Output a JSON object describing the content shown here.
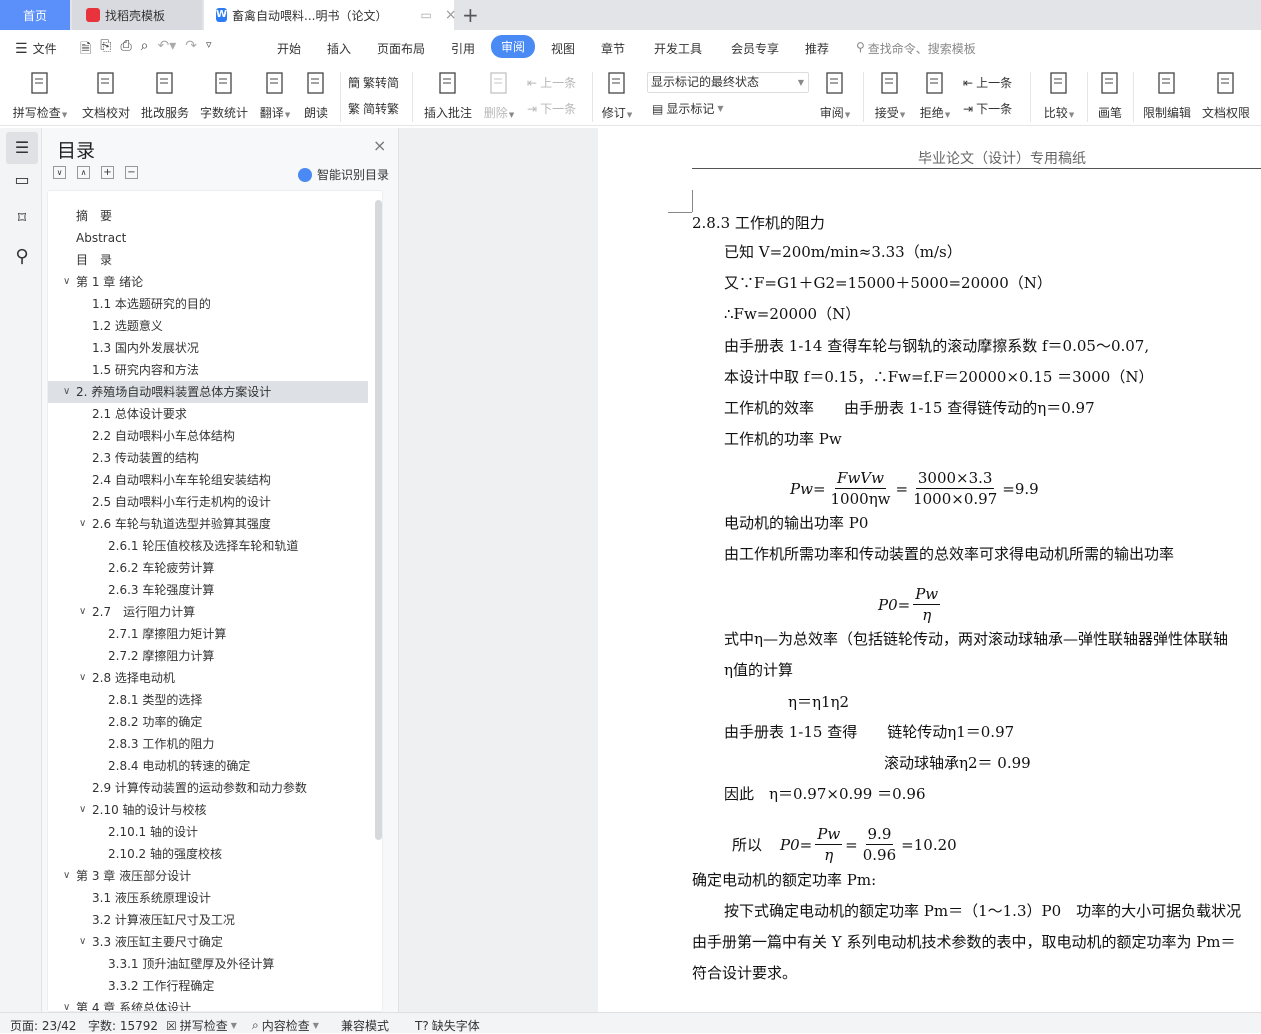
{
  "tabs": {
    "home": "首页",
    "template": "找稻壳模板",
    "doc": "畜禽自动喂料...明书（论文）",
    "new": "+"
  },
  "colors": {
    "accent": "#4a8af4",
    "home_tab": "#5b8ff9",
    "template_icon": "#e8323c",
    "doc_icon": "#2b7cf6"
  },
  "menu": {
    "file": "文件",
    "tabs": [
      "开始",
      "插入",
      "页面布局",
      "引用",
      "审阅",
      "视图",
      "章节",
      "开发工具",
      "会员专享",
      "推荐"
    ],
    "active": "审阅",
    "search_placeholder": "查找命令、搜索模板"
  },
  "ribbon": {
    "big": [
      {
        "label": "拼写检查",
        "dd": true,
        "icon": "spellcheck-icon"
      },
      {
        "label": "文档校对",
        "icon": "proofread-icon"
      },
      {
        "label": "批改服务",
        "icon": "correction-service-icon"
      },
      {
        "label": "字数统计",
        "icon": "word-count-icon"
      },
      {
        "label": "翻译",
        "dd": true,
        "icon": "translate-icon"
      },
      {
        "label": "朗读",
        "icon": "read-aloud-icon"
      },
      {
        "label": "插入批注",
        "icon": "insert-comment-icon"
      },
      {
        "label": "删除",
        "dd": true,
        "disabled": true,
        "icon": "delete-comment-icon"
      },
      {
        "label": "修订",
        "dd": true,
        "icon": "track-changes-icon"
      },
      {
        "label": "审阅",
        "dd": true,
        "icon": "review-pane-icon"
      },
      {
        "label": "接受",
        "dd": true,
        "icon": "accept-icon"
      },
      {
        "label": "拒绝",
        "dd": true,
        "icon": "reject-icon"
      },
      {
        "label": "比较",
        "dd": true,
        "icon": "compare-icon"
      },
      {
        "label": "画笔",
        "icon": "pen-icon"
      },
      {
        "label": "限制编辑",
        "icon": "restrict-edit-icon"
      },
      {
        "label": "文档权限",
        "icon": "doc-permission-icon"
      }
    ],
    "trad_to_simp": "繁转简",
    "simp_to_trad": "简转繁",
    "prev_comment": "上一条",
    "next_comment": "下一条",
    "markup_state": "显示标记的最终状态",
    "show_markup": "显示标记",
    "prev_change": "上一条",
    "next_change": "下一条"
  },
  "nav": {
    "title": "目录",
    "smart": "智能识别目录",
    "items": [
      {
        "t": "摘　要",
        "l": 0
      },
      {
        "t": "Abstract",
        "l": 0
      },
      {
        "t": "目　录",
        "l": 0
      },
      {
        "t": "第 1 章  绪论",
        "l": 0,
        "c": true
      },
      {
        "t": "1.1 本选题研究的目的",
        "l": 1
      },
      {
        "t": "1.2 选题意义",
        "l": 1
      },
      {
        "t": "1.3 国内外发展状况",
        "l": 1
      },
      {
        "t": "1.5 研究内容和方法",
        "l": 1
      },
      {
        "t": "2.  养殖场自动喂料装置总体方案设计",
        "l": 0,
        "c": true,
        "sel": true
      },
      {
        "t": "2.1  总体设计要求",
        "l": 1
      },
      {
        "t": "2.2  自动喂料小车总体结构",
        "l": 1
      },
      {
        "t": "2.3  传动装置的结构",
        "l": 1
      },
      {
        "t": "2.4  自动喂料小车车轮组安装结构",
        "l": 1
      },
      {
        "t": "2.5 自动喂料小车行走机构的设计",
        "l": 1
      },
      {
        "t": "2.6 车轮与轨道选型并验算其强度",
        "l": 1,
        "c": true
      },
      {
        "t": "2.6.1 轮压值校核及选择车轮和轨道",
        "l": 2
      },
      {
        "t": "2.6.2 车轮疲劳计算",
        "l": 2
      },
      {
        "t": "2.6.3 车轮强度计算",
        "l": 2
      },
      {
        "t": "2.7　运行阻力计算",
        "l": 1,
        "c": true
      },
      {
        "t": "2.7.1 摩擦阻力矩计算",
        "l": 2
      },
      {
        "t": "2.7.2 摩擦阻力计算",
        "l": 2
      },
      {
        "t": "2.8  选择电动机",
        "l": 1,
        "c": true
      },
      {
        "t": "2.8.1 类型的选择",
        "l": 2
      },
      {
        "t": "2.8.2 功率的确定",
        "l": 2
      },
      {
        "t": "2.8.3 工作机的阻力",
        "l": 2
      },
      {
        "t": "2.8.4 电动机的转速的确定",
        "l": 2
      },
      {
        "t": "2.9 计算传动装置的运动参数和动力参数",
        "l": 1
      },
      {
        "t": "2.10 轴的设计与校核",
        "l": 1,
        "c": true
      },
      {
        "t": "2.10.1 轴的设计",
        "l": 2
      },
      {
        "t": "2.10.2  轴的强度校核",
        "l": 2
      },
      {
        "t": "第 3 章  液压部分设计",
        "l": 0,
        "c": true
      },
      {
        "t": "3.1  液压系统原理设计",
        "l": 1
      },
      {
        "t": "3.2 计算液压缸尺寸及工况",
        "l": 1
      },
      {
        "t": "3.3 液压缸主要尺寸确定",
        "l": 1,
        "c": true
      },
      {
        "t": "3.3.1 顶升油缸壁厚及外径计算",
        "l": 2
      },
      {
        "t": "3.3.2 工作行程确定",
        "l": 2
      },
      {
        "t": "第 4 章  系统总体设计",
        "l": 0,
        "c": true
      }
    ]
  },
  "doc": {
    "header": "毕业论文（设计）专用稿纸",
    "heading": "2.8.3 工作机的阻力",
    "lines": [
      "已知 V=200m/min≈3.33（m/s）",
      "又∵F=G1＋G2=15000＋5000=20000（N）",
      "∴Fw=20000（N）",
      "由手册表 1-14 查得车轮与钢轨的滚动摩擦系数 f＝0.05～0.07,",
      "本设计中取  f＝0.15，∴Fw=f.F＝20000×0.15  ＝3000（N）",
      "工作机的效率　　由手册表 1-15 查得链传动的η＝0.97",
      "工作机的功率 Pw",
      "电动机的输出功率  P0",
      "由工作机所需功率和传动装置的总效率可求得电动机所需的输出功率",
      "式中η—为总效率（包括链轮传动，两对滚动球轴承—弹性联轴器弹性体联轴",
      "η值的计算",
      "η＝η1η2",
      "由手册表 1-15 查得　　链轮传动η1＝0.97",
      "滚动球轴承η2＝  0.99",
      "因此　η＝0.97×0.99  ＝0.96",
      "确定电动机的额定功率  Pm:",
      "按下式确定电动机的额定功率 Pm＝（1～1.3）P0　功率的大小可据负载状况",
      "由手册第一篇中有关 Y 系列电动机技术参数的表中，取电动机的额定功率为 Pm＝",
      "符合设计要求。"
    ],
    "f1": {
      "lhs": "Pw",
      "n1": "FwVw",
      "d1": "1000ηw",
      "n2": "3000×3.3",
      "d2": "1000×0.97",
      "r": "9.9"
    },
    "f2": {
      "lhs": "P0",
      "n": "Pw",
      "d": "η"
    },
    "f3": {
      "pre": "所以",
      "lhs": "P0",
      "n1": "Pw",
      "d1": "η",
      "n2": "9.9",
      "d2": "0.96",
      "r": "10.20"
    }
  },
  "status": {
    "page": "页面: 23/42",
    "words": "字数: 15792",
    "spell": "拼写检查",
    "content": "内容检查",
    "compat": "兼容模式",
    "font": "缺失字体"
  }
}
